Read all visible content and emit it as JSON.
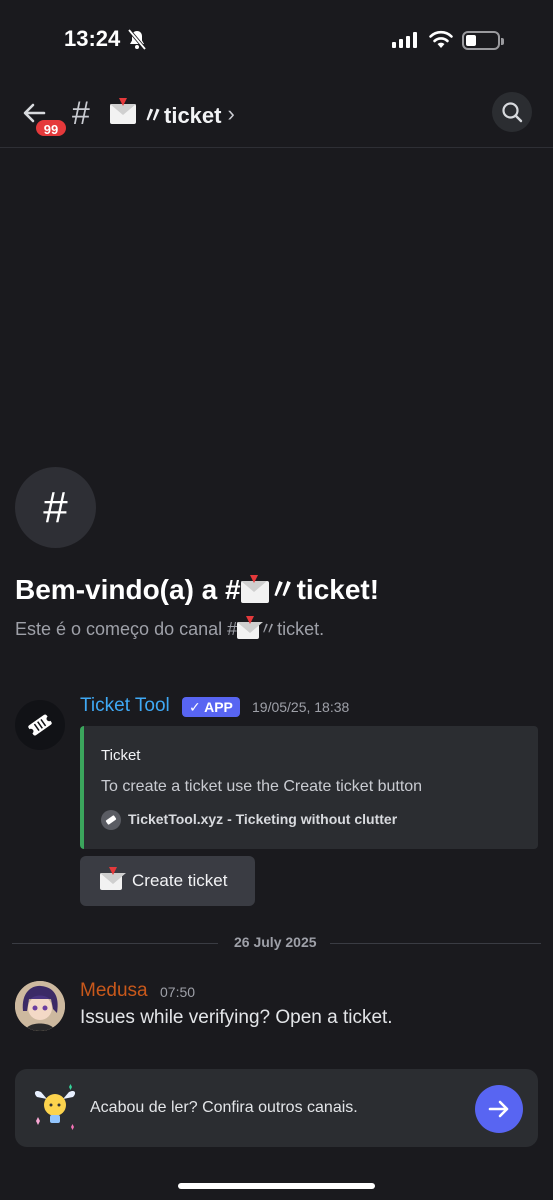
{
  "status_bar": {
    "time": "13:24"
  },
  "header": {
    "unread_badge": "99",
    "channel_hash": "#",
    "channel_name": "〃ticket",
    "chevron": "›"
  },
  "welcome": {
    "hash": "#",
    "title_prefix": "Bem-vindo(a) a #",
    "title_suffix": "〃ticket!",
    "subtitle_prefix": "Este é o começo do canal #",
    "subtitle_suffix": "〃ticket."
  },
  "bot_message": {
    "author": "Ticket Tool",
    "app_tag": "✓ APP",
    "timestamp": "19/05/25, 18:38",
    "embed": {
      "title": "Ticket",
      "description": "To create a ticket use the Create ticket button",
      "footer": "TicketTool.xyz - Ticketing without clutter",
      "accent_color": "#3ba55c"
    },
    "button_label": "Create ticket"
  },
  "date_divider": "26 July 2025",
  "user_message": {
    "author": "Medusa",
    "timestamp": "07:50",
    "text": "Issues while verifying? Open a ticket.",
    "author_color": "#c8581b"
  },
  "bottom_card": {
    "text": "Acabou de ler? Confira outros canais."
  },
  "colors": {
    "background": "#1a1a1e",
    "blurple": "#5865f2",
    "bot_name": "#3fa9f5",
    "badge": "#e5393b"
  }
}
